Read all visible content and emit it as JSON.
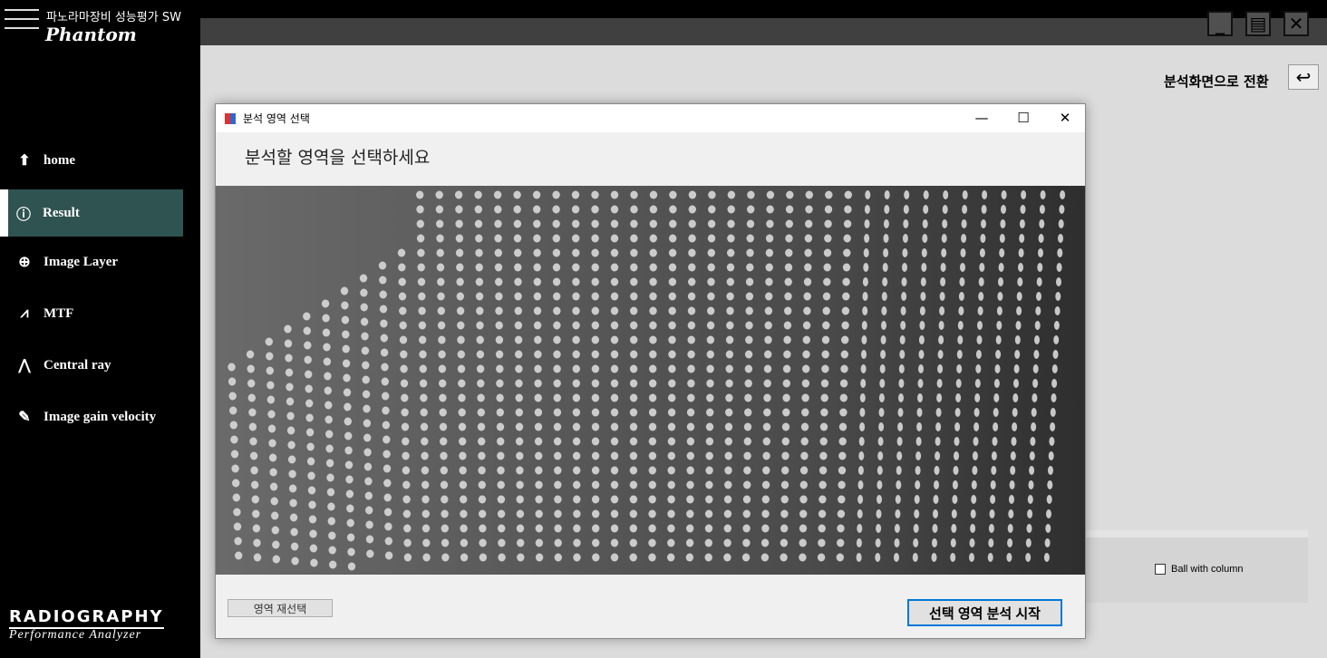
{
  "app": {
    "title": "파노라마장비 성능평가 SW",
    "logo": "Phantom",
    "brand_line1": "RADIOGRAPHY",
    "brand_line2": "Performance Analyzer"
  },
  "sidebar": {
    "items": [
      {
        "label": "home",
        "icon": "home-arrow-icon"
      },
      {
        "label": "Result",
        "icon": "info-icon",
        "selected": true
      },
      {
        "label": "Image Layer",
        "icon": "crosshair-icon"
      },
      {
        "label": "MTF",
        "icon": "waveform-icon"
      },
      {
        "label": "Central ray",
        "icon": "ray-icon"
      },
      {
        "label": "Image gain velocity",
        "icon": "pen-icon"
      }
    ],
    "selected_color": "#2f5350"
  },
  "main": {
    "switch_label": "분석화면으로 전환",
    "checkbox_label": "Ball  with  column",
    "checkbox_checked": false
  },
  "dialog": {
    "title": "분석 영역 선택",
    "heading": "분석할 영역을 선택하세요",
    "reselect_label": "영역 재선택",
    "start_label": "선택 영역 분석 시작"
  }
}
